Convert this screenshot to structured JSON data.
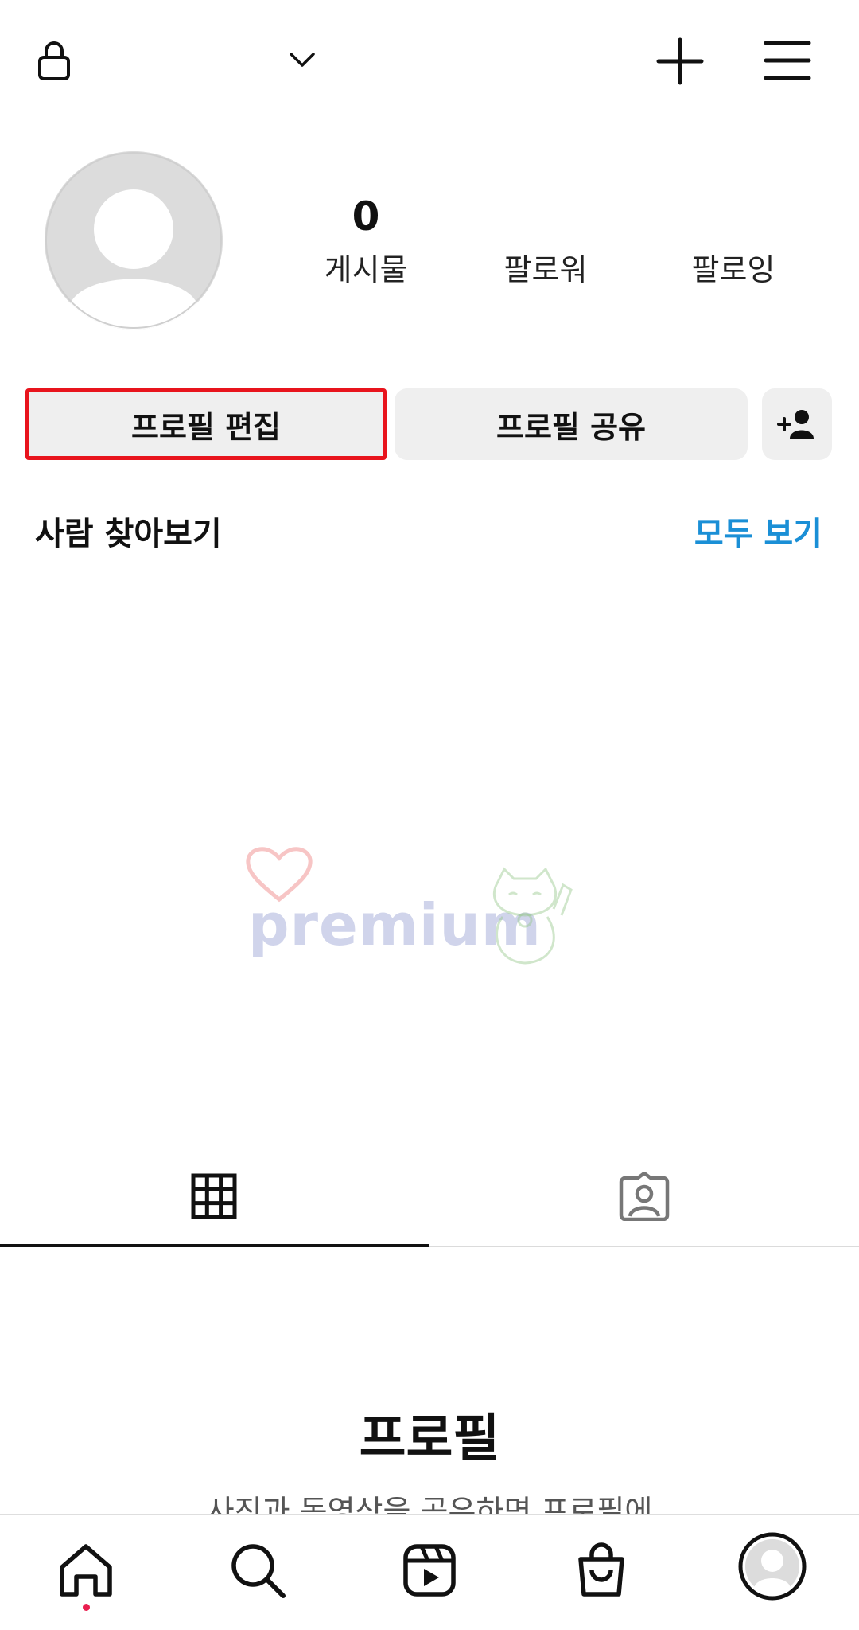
{
  "header": {
    "lock_icon": "lock-icon",
    "dropdown_icon": "chevron-down-icon",
    "create_icon": "plus-icon",
    "menu_icon": "hamburger-menu-icon"
  },
  "profile": {
    "avatar_icon": "default-avatar-icon",
    "stats": [
      {
        "value": "0",
        "label": "게시물"
      },
      {
        "value": "",
        "label": "팔로워"
      },
      {
        "value": "",
        "label": "팔로잉"
      }
    ]
  },
  "actions": {
    "edit_profile": "프로필 편집",
    "share_profile": "프로필 공유",
    "add_user_icon": "add-person-icon",
    "highlight_color": "#e8141d"
  },
  "discover": {
    "title": "사람 찾아보기",
    "see_all": "모두 보기",
    "link_color": "#1a8fd6"
  },
  "watermark": {
    "text": "premium"
  },
  "tabs": {
    "grid_icon": "grid-icon",
    "tagged_icon": "tagged-person-icon"
  },
  "empty_state": {
    "title": "프로필",
    "description": "사진과 동영상을 공유하면 프로필에"
  },
  "bottom_nav": {
    "items": [
      "home-icon",
      "search-icon",
      "reels-icon",
      "shop-icon",
      "profile-avatar-icon"
    ],
    "notification_dot_color": "#e91e4f"
  }
}
